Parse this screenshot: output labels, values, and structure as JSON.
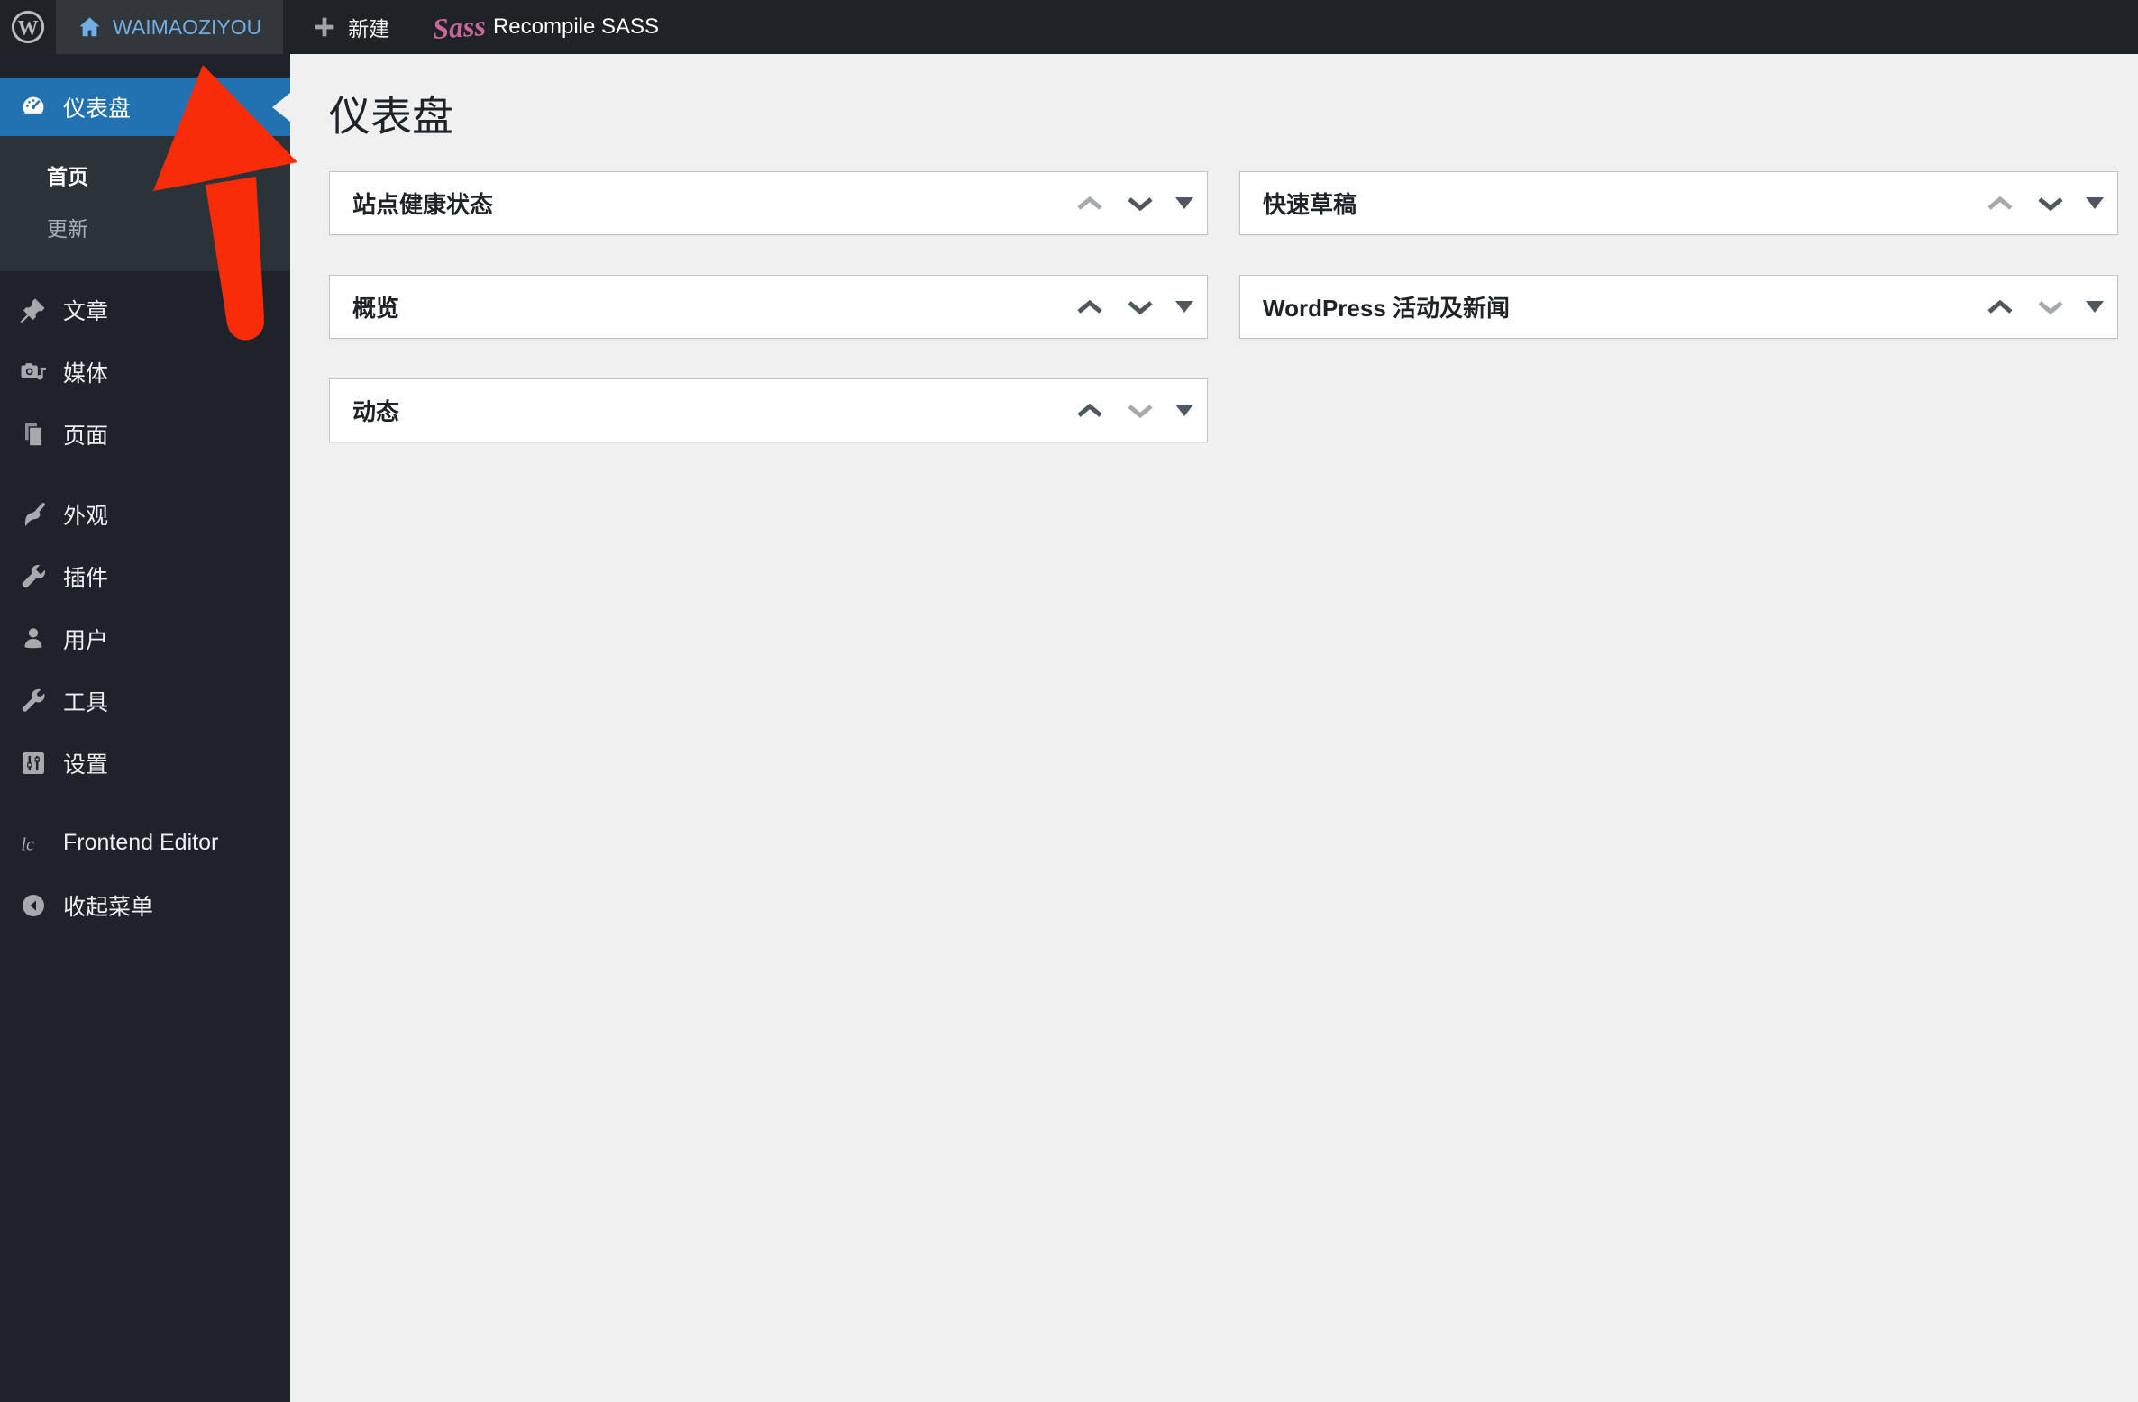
{
  "topbar": {
    "wp_logo_letter": "W",
    "site_name": "WAIMAOZIYOU",
    "new_button": "新建",
    "sass_logo": "Sass",
    "recompile_button": "Recompile SASS"
  },
  "sidebar": {
    "items": [
      {
        "label": "仪表盘",
        "active": true
      },
      {
        "label": "文章"
      },
      {
        "label": "媒体"
      },
      {
        "label": "页面"
      },
      {
        "label": "外观"
      },
      {
        "label": "插件"
      },
      {
        "label": "用户"
      },
      {
        "label": "工具"
      },
      {
        "label": "设置"
      },
      {
        "label": "Frontend Editor"
      },
      {
        "label": "收起菜单"
      }
    ],
    "submenu": [
      {
        "label": "首页",
        "current": true
      },
      {
        "label": "更新"
      }
    ]
  },
  "main": {
    "page_title": "仪表盘",
    "widgets": [
      {
        "title": "站点健康状态"
      },
      {
        "title": "快速草稿"
      },
      {
        "title": "概览"
      },
      {
        "title": "WordPress 活动及新闻"
      },
      {
        "title": "动态"
      }
    ]
  },
  "colors": {
    "accent_blue": "#2271b1",
    "topbar_link_blue": "#72aee6",
    "sass_pink": "#cd6799",
    "annotation_arrow_red": "#f92c0a",
    "admin_dark": "#1e222b",
    "content_bg": "#f0f0f1"
  }
}
